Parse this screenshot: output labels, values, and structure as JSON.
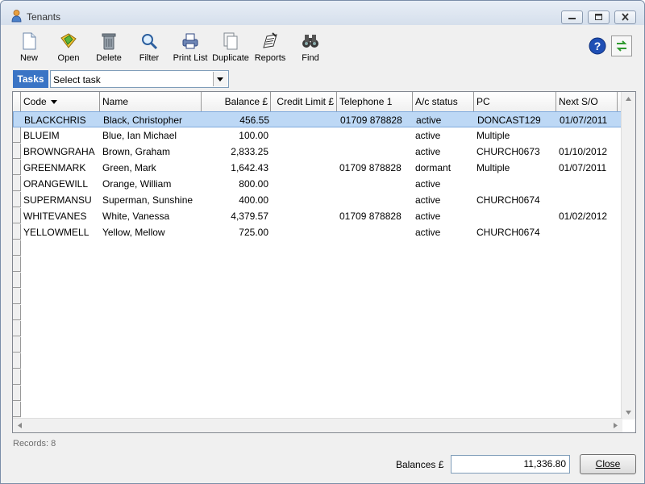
{
  "window": {
    "title": "Tenants"
  },
  "toolbar": [
    {
      "label": "New",
      "icon": "new-document-icon"
    },
    {
      "label": "Open",
      "icon": "open-folder-icon"
    },
    {
      "label": "Delete",
      "icon": "trash-can-icon"
    },
    {
      "label": "Filter",
      "icon": "magnifier-icon"
    },
    {
      "label": "Print List",
      "icon": "printer-icon"
    },
    {
      "label": "Duplicate",
      "icon": "duplicate-icon"
    },
    {
      "label": "Reports",
      "icon": "reports-icon"
    },
    {
      "label": "Find",
      "icon": "binoculars-icon"
    }
  ],
  "tasks": {
    "label": "Tasks",
    "value": "Select task"
  },
  "table": {
    "columns": [
      "Code",
      "Name",
      "Balance £",
      "Credit Limit £",
      "Telephone 1",
      "A/c status",
      "PC",
      "Next S/O"
    ],
    "sort_column": "Code",
    "selected_row": 0,
    "rows": [
      [
        "BLACKCHRIS",
        "Black, Christopher",
        "456.55",
        "",
        "01709 878828",
        "active",
        "DONCAST129",
        "01/07/2011"
      ],
      [
        "BLUEIM",
        "Blue, Ian Michael",
        "100.00",
        "",
        "",
        "active",
        "Multiple",
        ""
      ],
      [
        "BROWNGRAHA",
        "Brown, Graham",
        "2,833.25",
        "",
        "",
        "active",
        "CHURCH0673",
        "01/10/2012"
      ],
      [
        "GREENMARK",
        "Green, Mark",
        "1,642.43",
        "",
        "01709 878828",
        "dormant",
        "Multiple",
        "01/07/2011"
      ],
      [
        "ORANGEWILL",
        "Orange, William",
        "800.00",
        "",
        "",
        "active",
        "",
        ""
      ],
      [
        "SUPERMANSU",
        "Superman, Sunshine",
        "400.00",
        "",
        "",
        "active",
        "CHURCH0674",
        ""
      ],
      [
        "WHITEVANES",
        "White, Vanessa",
        "4,379.57",
        "",
        "01709 878828",
        "active",
        "",
        "01/02/2012"
      ],
      [
        "YELLOWMELL",
        "Yellow, Mellow",
        "725.00",
        "",
        "",
        "active",
        "CHURCH0674",
        ""
      ]
    ]
  },
  "status": {
    "records": "Records: 8"
  },
  "footer": {
    "balances_label": "Balances £",
    "balances_value": "11,336.80",
    "close_label": "Close"
  },
  "colors": {
    "selection": "#bdd8f5",
    "tasks_bg": "#3a74c5"
  }
}
